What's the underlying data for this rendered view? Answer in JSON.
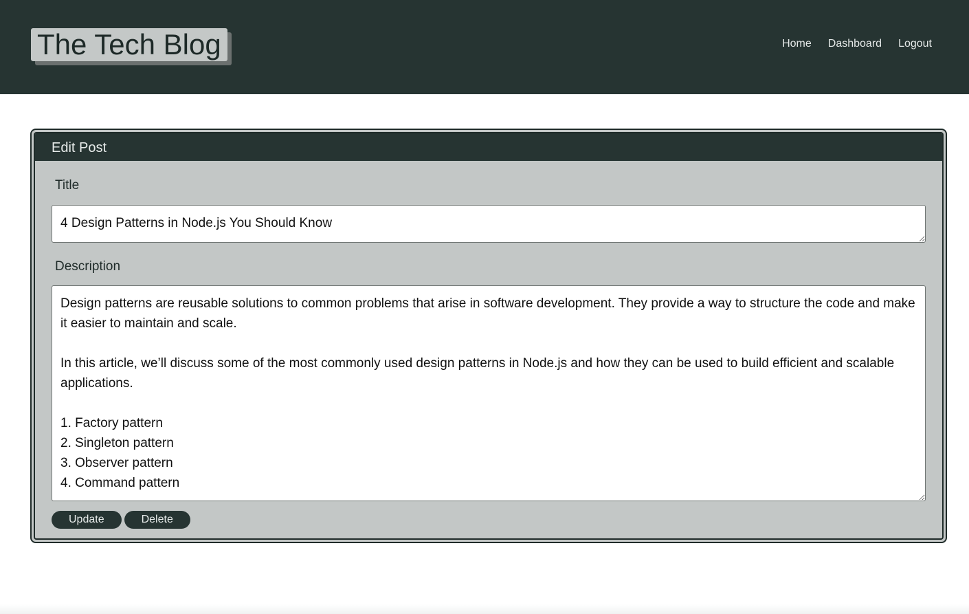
{
  "header": {
    "logo": "The Tech Blog",
    "nav": [
      {
        "label": "Home"
      },
      {
        "label": "Dashboard"
      },
      {
        "label": "Logout"
      }
    ]
  },
  "edit_post": {
    "heading": "Edit Post",
    "title_label": "Title",
    "title_value": "4 Design Patterns in Node.js You Should Know",
    "description_label": "Description",
    "description_value": "Design patterns are reusable solutions to common problems that arise in software development. They provide a way to structure the code and make it easier to maintain and scale.\n\nIn this article, we’ll discuss some of the most commonly used design patterns in Node.js and how they can be used to build efficient and scalable applications.\n\n1. Factory pattern\n2. Singleton pattern\n3. Observer pattern\n4. Command pattern",
    "update_label": "Update",
    "delete_label": "Delete"
  },
  "colors": {
    "header_bg": "#263432",
    "card_bg": "#c3c7c6",
    "logo_bg": "#c4c8c7",
    "button_bg": "#263432"
  }
}
